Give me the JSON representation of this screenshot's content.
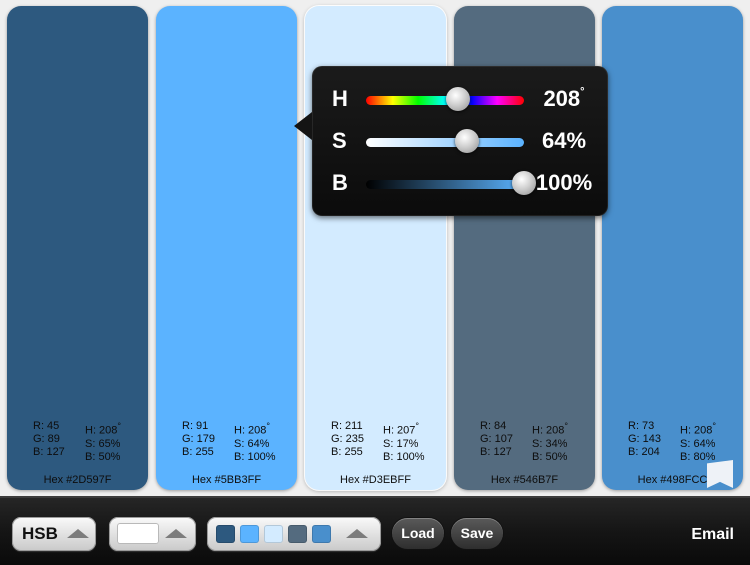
{
  "swatches": [
    {
      "hex_color": "#2D597F",
      "r": "R: 45",
      "g": "G: 89",
      "b": "B: 127",
      "h": "H: 208",
      "s": "S: 65%",
      "br": "B: 50%",
      "hex": "Hex #2D597F"
    },
    {
      "hex_color": "#5BB3FF",
      "r": "R: 91",
      "g": "G: 179",
      "b": "B: 255",
      "h": "H: 208",
      "s": "S: 64%",
      "br": "B: 100%",
      "hex": "Hex #5BB3FF"
    },
    {
      "hex_color": "#D3EBFF",
      "r": "R: 211",
      "g": "G: 235",
      "b": "B: 255",
      "h": "H: 207",
      "s": "S: 17%",
      "br": "B: 100%",
      "hex": "Hex #D3EBFF"
    },
    {
      "hex_color": "#546B7F",
      "r": "R: 84",
      "g": "G: 107",
      "b": "B: 127",
      "h": "H: 208",
      "s": "S: 34%",
      "br": "B: 50%",
      "hex": "Hex #546B7F"
    },
    {
      "hex_color": "#498FCC",
      "r": "R: 73",
      "g": "G: 143",
      "b": "B: 204",
      "h": "H: 208",
      "s": "S: 64%",
      "br": "B: 80%",
      "hex": "Hex #498FCC"
    }
  ],
  "degree_symbol": "°",
  "picker": {
    "h": {
      "label": "H",
      "value": "208",
      "unit": "°",
      "level": 0.58
    },
    "s": {
      "label": "S",
      "value": "64%",
      "level": 0.64
    },
    "b": {
      "label": "B",
      "value": "100%",
      "level": 1.0
    }
  },
  "toolbar": {
    "mode_label": "HSB",
    "load_label": "Load",
    "save_label": "Save",
    "email_label": "Email",
    "mini_palette": [
      "#2D597F",
      "#5BB3FF",
      "#D3EBFF",
      "#546B7F",
      "#498FCC"
    ],
    "color_field_color": "#FFFFFF"
  },
  "icons": [
    "bookmark-flag-icon",
    "expand-arrow-icon"
  ]
}
